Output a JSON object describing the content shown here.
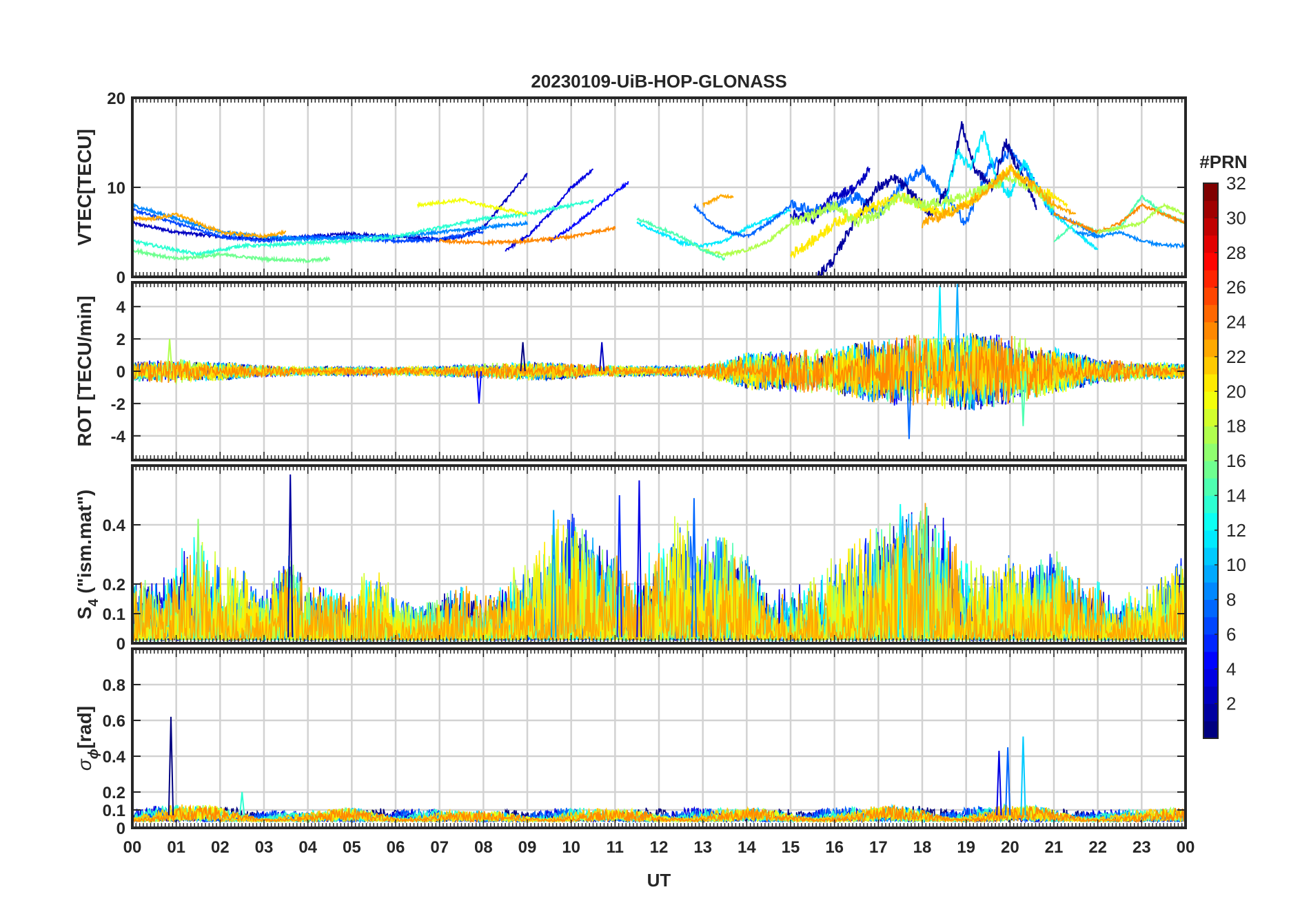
{
  "figure": {
    "title": "20230109-UiB-HOP-GLONASS",
    "xlabel": "UT",
    "x_ticks": [
      "00",
      "01",
      "02",
      "03",
      "04",
      "05",
      "06",
      "07",
      "08",
      "09",
      "10",
      "11",
      "12",
      "13",
      "14",
      "15",
      "16",
      "17",
      "18",
      "19",
      "20",
      "21",
      "22",
      "23",
      "00"
    ]
  },
  "colorbar": {
    "label": "#PRN",
    "min": 1,
    "max": 32,
    "ticks": [
      2,
      4,
      6,
      8,
      10,
      12,
      14,
      16,
      18,
      20,
      22,
      24,
      26,
      28,
      30,
      32
    ],
    "colormap": "jet"
  },
  "chart_data": [
    {
      "type": "line",
      "panel": "vtec",
      "ylabel": "VTEC[TECU]",
      "ylim": [
        0,
        20
      ],
      "yticks": [
        0,
        10,
        20
      ],
      "xlim": [
        0,
        24
      ],
      "grid": true,
      "series": [
        {
          "prn": 3,
          "x": [
            0,
            1,
            2,
            3,
            4,
            5,
            6,
            7,
            7.5,
            8,
            8.5,
            9
          ],
          "y": [
            6,
            5,
            4.5,
            4.2,
            4.5,
            4.8,
            4.5,
            4.2,
            4.5,
            5.5,
            8.5,
            11.5
          ]
        },
        {
          "prn": 4,
          "x": [
            8.5,
            9,
            9.5,
            10,
            10.5
          ],
          "y": [
            3,
            4.5,
            7,
            10,
            12
          ]
        },
        {
          "prn": 5,
          "x": [
            9.5,
            10,
            10.5,
            11,
            11.3
          ],
          "y": [
            4,
            5.5,
            7.5,
            9.5,
            10.5
          ]
        },
        {
          "prn": 7,
          "x": [
            0,
            1,
            2,
            3,
            4,
            5,
            6,
            7,
            8
          ],
          "y": [
            7.5,
            6,
            4.5,
            4,
            4.5,
            4.3,
            4,
            4.2,
            5
          ]
        },
        {
          "prn": 9,
          "x": [
            0,
            1,
            2,
            3,
            4,
            5,
            6,
            7,
            8,
            9
          ],
          "y": [
            8,
            6.5,
            5,
            4.5,
            4.2,
            4.5,
            4.5,
            5,
            5.5,
            6
          ]
        },
        {
          "prn": 14,
          "x": [
            0,
            0.5,
            1,
            1.5,
            2,
            2.5,
            3,
            4,
            5,
            6,
            7,
            8,
            9,
            10,
            10.5
          ],
          "y": [
            4,
            3.5,
            3,
            2.5,
            3,
            3.5,
            3.5,
            3.8,
            4,
            4.5,
            5.5,
            6.5,
            7,
            8,
            8.5
          ]
        },
        {
          "prn": 16,
          "x": [
            0,
            1,
            2,
            3,
            4,
            4.5
          ],
          "y": [
            3,
            2,
            2.5,
            2,
            1.8,
            2
          ]
        },
        {
          "prn": 20,
          "x": [
            6.5,
            7,
            7.5,
            8,
            8.5,
            9
          ],
          "y": [
            8,
            8.3,
            8.6,
            8,
            7.5,
            7
          ]
        },
        {
          "prn": 23,
          "x": [
            0,
            0.5,
            1,
            2,
            3,
            3.5
          ],
          "y": [
            6.5,
            6.5,
            7,
            5,
            4.5,
            5
          ]
        },
        {
          "prn": 24,
          "x": [
            7,
            8,
            9,
            10,
            10.5,
            11
          ],
          "y": [
            4,
            3.8,
            4,
            4.5,
            5,
            5.5
          ]
        },
        {
          "prn": 12,
          "x": [
            11.5,
            12,
            12.5,
            13,
            13.5,
            14,
            14.5,
            15
          ],
          "y": [
            6,
            5,
            3.8,
            3.5,
            4,
            5.5,
            6.5,
            7.5
          ]
        },
        {
          "prn": 8,
          "x": [
            12.8,
            13.2,
            13.6,
            14,
            14.5,
            15,
            15.5,
            16,
            16.5,
            17,
            17.5,
            18,
            18.5,
            19,
            19.5,
            20,
            20.5,
            21,
            21.5,
            22
          ],
          "y": [
            8,
            6,
            5,
            4.5,
            6,
            8,
            7.5,
            8,
            9,
            7,
            10,
            12,
            9,
            6,
            12,
            14,
            11,
            7,
            6,
            4.5
          ]
        },
        {
          "prn": 2,
          "x": [
            15.6,
            16,
            16.3,
            16.7,
            17,
            17.4,
            17.8,
            18.2,
            18.6,
            18.9,
            19.2,
            19.6,
            19.9,
            20.2,
            20.6
          ],
          "y": [
            0,
            2,
            5,
            8,
            10,
            11,
            9,
            7,
            10,
            17,
            12,
            10,
            15,
            12,
            8
          ]
        },
        {
          "prn": 3,
          "x": [
            15,
            15.5,
            16,
            16.5,
            16.8
          ],
          "y": [
            7,
            6.5,
            9,
            10,
            12
          ]
        },
        {
          "prn": 12,
          "x": [
            18.5,
            18.8,
            19.1,
            19.4,
            19.7,
            20,
            20.3,
            20.6,
            21,
            21.5,
            22
          ],
          "y": [
            8,
            14,
            12,
            16,
            11,
            9,
            13,
            10,
            7,
            5,
            3
          ]
        },
        {
          "prn": 21,
          "x": [
            15,
            15.5,
            16,
            16.5,
            17,
            17.5,
            18,
            18.5,
            19,
            19.5,
            20,
            20.5,
            21,
            21.3
          ],
          "y": [
            2.5,
            4,
            6,
            7,
            8,
            9,
            8,
            7,
            8,
            10,
            12,
            10,
            9,
            8
          ]
        },
        {
          "prn": 18,
          "x": [
            13,
            13.5,
            14,
            14.5,
            15,
            15.5,
            16,
            16.5,
            17,
            17.5,
            18,
            19,
            20,
            20.5,
            21
          ],
          "y": [
            3,
            2.5,
            3,
            4,
            6,
            7,
            8,
            6,
            7,
            9,
            8,
            9,
            11,
            10,
            8
          ]
        },
        {
          "prn": 23,
          "x": [
            18,
            18.5,
            19,
            19.5,
            20,
            20.3,
            20.6,
            21,
            21.5
          ],
          "y": [
            6,
            7,
            8,
            10,
            12,
            11,
            10,
            8,
            7
          ]
        },
        {
          "prn": 23,
          "x": [
            13,
            13.4,
            13.7
          ],
          "y": [
            8,
            9,
            9
          ]
        },
        {
          "prn": 15,
          "x": [
            11.5,
            12,
            12.5,
            13,
            13.5
          ],
          "y": [
            6.5,
            5.5,
            4.5,
            3,
            2
          ]
        },
        {
          "prn": 15,
          "x": [
            21,
            21.5,
            22,
            22.5,
            23,
            23.5,
            24
          ],
          "y": [
            4,
            6,
            5,
            5.5,
            9,
            7,
            6
          ]
        },
        {
          "prn": 24,
          "x": [
            21,
            21.5,
            22,
            22.5,
            23,
            23.5,
            24
          ],
          "y": [
            7,
            6,
            5,
            6,
            8,
            7,
            6
          ]
        },
        {
          "prn": 9,
          "x": [
            21.5,
            22,
            22.5,
            23,
            23.5,
            24
          ],
          "y": [
            5,
            4.5,
            5,
            4,
            3.5,
            3.5
          ]
        },
        {
          "prn": 18,
          "x": [
            22,
            22.5,
            23,
            23.5,
            24
          ],
          "y": [
            5,
            5.5,
            6,
            8,
            7
          ]
        }
      ]
    },
    {
      "type": "line",
      "panel": "rot",
      "ylabel": "ROT [TECU/min]",
      "ylim": [
        -5.5,
        5.5
      ],
      "yticks": [
        -4,
        -2,
        0,
        2,
        4
      ],
      "xlim": [
        0,
        24
      ],
      "grid": true,
      "activity_envelope": {
        "hours": [
          0,
          1,
          2,
          3,
          4,
          5,
          6,
          7,
          8,
          9,
          10,
          11,
          12,
          13,
          13.5,
          14,
          15,
          16,
          16.5,
          17,
          17.5,
          18,
          18.5,
          19,
          19.5,
          20,
          20.5,
          21,
          22,
          23,
          24
        ],
        "amplitude": [
          0.6,
          0.8,
          0.6,
          0.4,
          0.3,
          0.3,
          0.3,
          0.3,
          0.5,
          0.6,
          0.5,
          0.4,
          0.3,
          0.4,
          0.8,
          1.2,
          1.3,
          1.5,
          1.8,
          2,
          2.2,
          2.4,
          2.4,
          2.5,
          2.3,
          2.3,
          2,
          1.5,
          0.8,
          0.6,
          0.5
        ]
      },
      "notable_excursions": [
        {
          "x": 8.9,
          "y": 1.8
        },
        {
          "x": 10.7,
          "y": 1.8
        },
        {
          "x": 7.9,
          "y": -2
        },
        {
          "x": 17.7,
          "y": -4.2
        },
        {
          "x": 18.8,
          "y": 5.4
        },
        {
          "x": 18.4,
          "y": 5.3
        },
        {
          "x": 20.3,
          "y": -3.4
        },
        {
          "x": 0.85,
          "y": 2
        }
      ],
      "series_prns": [
        1,
        3,
        5,
        8,
        10,
        12,
        15,
        18,
        20,
        22,
        24
      ]
    },
    {
      "type": "line",
      "panel": "s4",
      "ylabel": "S",
      "ylabel_sub": "4",
      "ylabel_suffix": " (\"ism.mat\")",
      "ylim": [
        0,
        0.6
      ],
      "yticks": [
        0,
        0.1,
        0.2,
        0.4
      ],
      "xlim": [
        0,
        24
      ],
      "grid": true,
      "activity_envelope": {
        "hours": [
          0,
          0.5,
          1,
          1.5,
          2,
          2.5,
          3,
          3.5,
          4,
          4.5,
          5,
          5.5,
          6,
          6.5,
          7,
          7.5,
          8,
          8.5,
          9,
          9.5,
          10,
          10.5,
          11,
          11.5,
          12,
          12.5,
          13,
          13.5,
          14,
          14.5,
          15,
          15.5,
          16,
          16.5,
          17,
          17.5,
          18,
          18.5,
          19,
          19.5,
          20,
          20.5,
          21,
          21.5,
          22,
          22.5,
          23,
          23.5,
          24
        ],
        "amplitude": [
          0.22,
          0.2,
          0.3,
          0.4,
          0.3,
          0.25,
          0.15,
          0.3,
          0.2,
          0.18,
          0.2,
          0.3,
          0.15,
          0.12,
          0.15,
          0.2,
          0.15,
          0.25,
          0.3,
          0.38,
          0.45,
          0.35,
          0.3,
          0.2,
          0.4,
          0.45,
          0.35,
          0.4,
          0.3,
          0.15,
          0.2,
          0.25,
          0.3,
          0.35,
          0.4,
          0.42,
          0.48,
          0.45,
          0.35,
          0.25,
          0.3,
          0.25,
          0.32,
          0.22,
          0.2,
          0.18,
          0.2,
          0.22,
          0.3
        ]
      },
      "notable_peaks": [
        {
          "x": 3.6,
          "y": 0.57
        },
        {
          "x": 11.55,
          "y": 0.55
        },
        {
          "x": 11.1,
          "y": 0.5
        },
        {
          "x": 12.8,
          "y": 0.49
        },
        {
          "x": 9.6,
          "y": 0.45
        },
        {
          "x": 17.5,
          "y": 0.47
        },
        {
          "x": 18.1,
          "y": 0.46
        },
        {
          "x": 1.5,
          "y": 0.42
        }
      ],
      "series_prns": [
        2,
        4,
        6,
        8,
        10,
        13,
        15,
        17,
        19,
        21,
        23
      ]
    },
    {
      "type": "line",
      "panel": "sigma_phi",
      "ylabel": "σ",
      "ylabel_sub": "ϕ",
      "ylabel_suffix": "[rad]",
      "ylim": [
        0,
        1
      ],
      "yticks": [
        0,
        0.1,
        0.2,
        0.4,
        0.6,
        0.8
      ],
      "xlim": [
        0,
        24
      ],
      "grid": true,
      "baseline": 0.07,
      "activity_envelope": {
        "hours": [
          0,
          1,
          2,
          3,
          4,
          5,
          6,
          7,
          8,
          9,
          10,
          11,
          12,
          13,
          14,
          15,
          16,
          17,
          18,
          19,
          20,
          21,
          22,
          23,
          24
        ],
        "amplitude": [
          0.08,
          0.1,
          0.09,
          0.07,
          0.06,
          0.08,
          0.08,
          0.07,
          0.06,
          0.07,
          0.08,
          0.07,
          0.08,
          0.08,
          0.08,
          0.07,
          0.08,
          0.09,
          0.09,
          0.08,
          0.1,
          0.08,
          0.07,
          0.07,
          0.08
        ]
      },
      "notable_peaks": [
        {
          "x": 0.88,
          "y": 0.62
        },
        {
          "x": 19.75,
          "y": 0.43
        },
        {
          "x": 19.95,
          "y": 0.45
        },
        {
          "x": 20.3,
          "y": 0.51
        },
        {
          "x": 2.5,
          "y": 0.2
        }
      ],
      "series_prns": [
        1,
        4,
        8,
        11,
        14,
        17,
        20,
        22,
        24
      ]
    }
  ]
}
